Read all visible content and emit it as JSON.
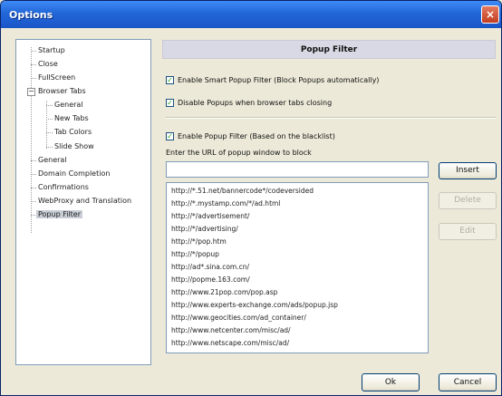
{
  "window": {
    "title": "Options",
    "close_glyph": "×"
  },
  "tree": {
    "items": [
      {
        "label": "Startup"
      },
      {
        "label": "Close"
      },
      {
        "label": "FullScreen"
      },
      {
        "label": "Browser Tabs",
        "expander": "−"
      },
      {
        "label": "General"
      },
      {
        "label": "New Tabs"
      },
      {
        "label": "Tab Colors"
      },
      {
        "label": "Slide Show"
      },
      {
        "label": "General"
      },
      {
        "label": "Domain Completion"
      },
      {
        "label": "Confirmations"
      },
      {
        "label": "WebProxy and Translation"
      },
      {
        "label": "Popup Filter"
      }
    ]
  },
  "panel": {
    "title": "Popup Filter",
    "check_glyph": "✓",
    "options": [
      {
        "label": "Enable Smart Popup Filter (Block Popups automatically)",
        "checked": true
      },
      {
        "label": "Disable Popups when browser tabs closing",
        "checked": true
      },
      {
        "label": "Enable Popup Filter (Based on the blacklist)",
        "checked": true
      }
    ],
    "url_prompt": "Enter the URL of popup window to block",
    "url_input_value": "",
    "blacklist": [
      "http://*.51.net/bannercode*/codeversided",
      "http://*.mystamp.com/*/ad.html",
      "http://*/advertisement/",
      "http://*/advertising/",
      "http://*/pop.htm",
      "http://*/popup",
      "http://ad*.sina.com.cn/",
      "http://popme.163.com/",
      "http://www.21pop.com/pop.asp",
      "http://www.experts-exchange.com/ads/popup.jsp",
      "http://www.geocities.com/ad_container/",
      "http://www.netcenter.com/misc/ad/",
      "http://www.netscape.com/misc/ad/"
    ],
    "buttons": {
      "insert": "Insert",
      "delete": "Delete",
      "edit": "Edit"
    }
  },
  "footer": {
    "ok": "Ok",
    "cancel": "Cancel"
  }
}
